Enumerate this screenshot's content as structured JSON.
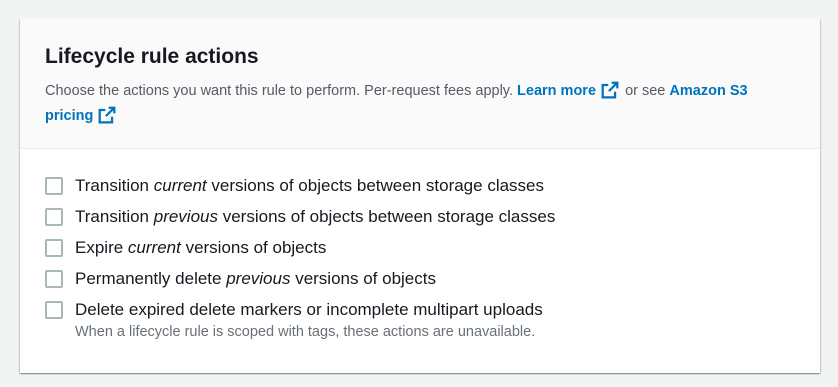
{
  "panel": {
    "title": "Lifecycle rule actions",
    "description_prefix": "Choose the actions you want this rule to perform. Per-request fees apply.",
    "learn_more_label": "Learn more",
    "or_see_text": "or see",
    "pricing_label": "Amazon S3 pricing"
  },
  "actions": [
    {
      "pre": "Transition ",
      "em": "current",
      "post": " versions of objects between storage classes",
      "checked": false
    },
    {
      "pre": "Transition ",
      "em": "previous",
      "post": " versions of objects between storage classes",
      "checked": false
    },
    {
      "pre": "Expire ",
      "em": "current",
      "post": " versions of objects",
      "checked": false
    },
    {
      "pre": "Permanently delete ",
      "em": "previous",
      "post": " versions of objects",
      "checked": false
    },
    {
      "pre": "Delete expired delete markers or incomplete multipart uploads",
      "em": "",
      "post": "",
      "checked": false,
      "description": "When a lifecycle rule is scoped with tags, these actions are unavailable."
    }
  ],
  "icons": {
    "external": "external-link-icon"
  },
  "colors": {
    "link": "#0073bb",
    "checkbox_border": "#aab7b8",
    "header_bg": "#fafafa"
  }
}
